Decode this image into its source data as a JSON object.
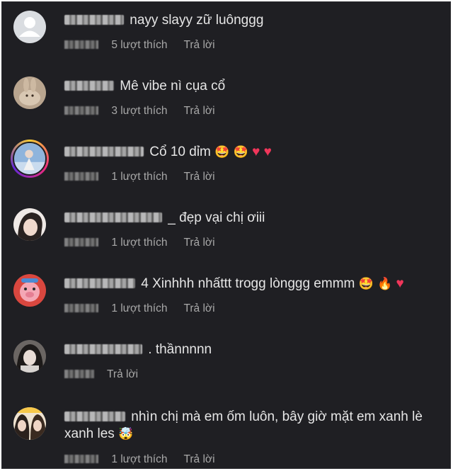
{
  "comments": [
    {
      "text": "nayy slayy zữ luônggg",
      "likes": "5 lượt thích",
      "reply": "Trả lời"
    },
    {
      "text": "Mê vibe nì cụa cổ",
      "likes": "3 lượt thích",
      "reply": "Trả lời"
    },
    {
      "text": "Cổ 10 dỉm",
      "emojis": [
        "star-struck-emoji",
        "star-struck-emoji",
        "heart-emoji",
        "heart-emoji"
      ],
      "likes": "1 lượt thích",
      "reply": "Trả lời"
    },
    {
      "text": "_ đẹp vại chị ơiii",
      "likes": "1 lượt thích",
      "reply": "Trả lời"
    },
    {
      "text": "4 Xinhhh nhấttt trogg lònggg emmm",
      "emojis": [
        "star-struck-emoji",
        "fire-emoji",
        "heart-emoji"
      ],
      "likes": "1 lượt thích",
      "reply": "Trả lời"
    },
    {
      "text": ". thầnnnnn",
      "likes": "",
      "reply": "Trả lời"
    },
    {
      "text": "nhìn chị mà em ốm luôn, bây giờ mặt em xanh lè xanh les",
      "emojis": [
        "exploding-head-emoji"
      ],
      "likes": "1 lượt thích",
      "reply": "Trả lời"
    }
  ],
  "colors": {
    "background": "#1f1f23",
    "text": "#e6e6e6",
    "meta": "#a8a8a8",
    "heart": "#f0365a"
  }
}
